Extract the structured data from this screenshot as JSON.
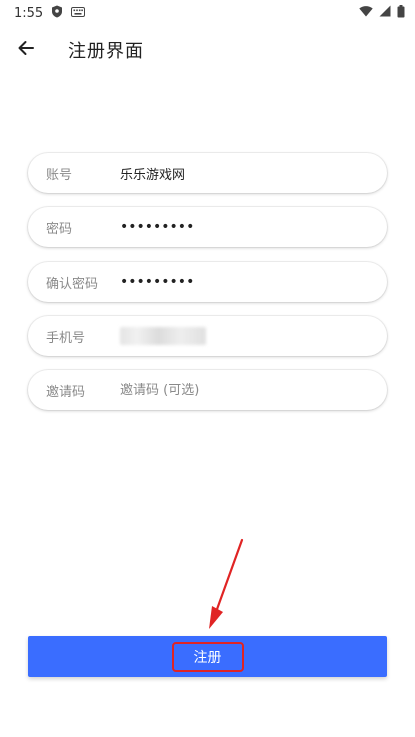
{
  "status_bar": {
    "time": "1:55"
  },
  "app_bar": {
    "title": "注册界面"
  },
  "form": {
    "account": {
      "label": "账号",
      "value": "乐乐游戏网"
    },
    "password": {
      "label": "密码",
      "value": "•••••••••"
    },
    "confirm_password": {
      "label": "确认密码",
      "value": "•••••••••"
    },
    "phone": {
      "label": "手机号"
    },
    "invite_code": {
      "label": "邀请码",
      "placeholder": "邀请码 (可选)"
    }
  },
  "register_button": {
    "label": "注册"
  },
  "colors": {
    "accent": "#3a6dff",
    "annotation": "#e02424"
  }
}
